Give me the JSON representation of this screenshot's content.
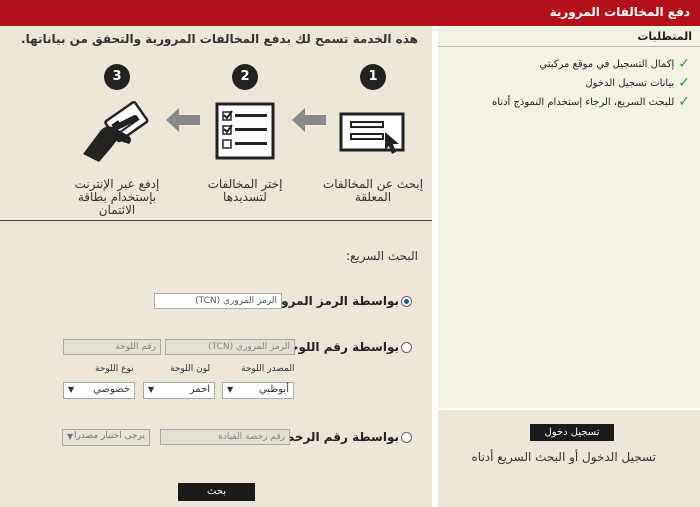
{
  "header": {
    "title": "دفع المخالفات المرورية"
  },
  "intro_text": "هذه الخدمة تسمح لك بدفع المخالفات المرورية والتحقق من بياناتها.",
  "steps": [
    {
      "number": "1",
      "caption": "إبحث عن المخالفات المعلقة",
      "icon": "form-click-icon"
    },
    {
      "number": "2",
      "caption": "إختر المخالفات لتسديدها",
      "icon": "checklist-icon"
    },
    {
      "number": "3",
      "caption": "إدفع عبر الإنترنت بإستخدام بطاقة الائتمان",
      "icon": "hand-card-icon"
    }
  ],
  "quick_search": {
    "label": "البحث السريع:",
    "by_tcn": {
      "label": "بواسطة الرمز المروري",
      "tcn_placeholder": "الرمز المروري (TCN)",
      "selected": true
    },
    "by_plate": {
      "label": "بواسطة رقم اللوحة",
      "tcn_placeholder": "الرمز المروري (TCN)",
      "plate_placeholder": "رقم اللوحة",
      "source_label": "المصدر اللوحة",
      "color_label": "لون اللوحة",
      "type_label": "نوع اللوحة",
      "source_value": "أبوظبي",
      "color_value": "احمر",
      "type_value": "خصوصي"
    },
    "by_license": {
      "label": "بواسطة رقم الرخصة",
      "license_placeholder": "رقم رخصة القيادة",
      "source_value": "يرجى اختيار مصدرا"
    },
    "search_button": "بحث"
  },
  "requirements": {
    "title": "المتطلبات",
    "items": [
      "إكمال التسجيل في موقع مركبتي",
      "بيانات تسجيل الدخول",
      "للبحث السريع، الرجاء إستخدام النموذج أدناه"
    ]
  },
  "login": {
    "button": "تسجيل دخول",
    "hint": "تسجيل الدخول أو البحث السريع أدناه"
  },
  "colors": {
    "brand_red": "#b3101a",
    "check_green": "#2a9a2a",
    "panel_bg": "#ece7d8"
  }
}
